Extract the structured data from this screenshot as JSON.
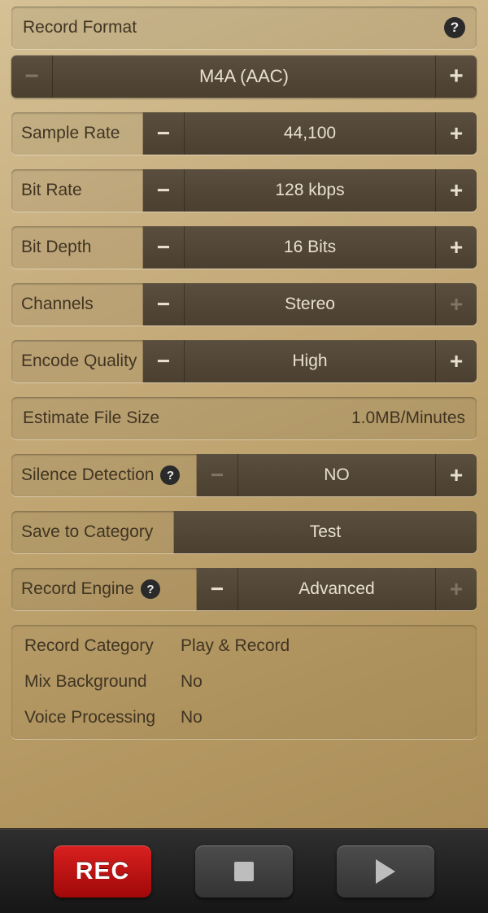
{
  "format": {
    "label": "Record Format",
    "value": "M4A (AAC)",
    "minus_enabled": false,
    "plus_enabled": true
  },
  "sample_rate": {
    "label": "Sample Rate",
    "value": "44,100"
  },
  "bit_rate": {
    "label": "Bit Rate",
    "value": "128 kbps"
  },
  "bit_depth": {
    "label": "Bit Depth",
    "value": "16 Bits"
  },
  "channels": {
    "label": "Channels",
    "value": "Stereo",
    "plus_enabled": false
  },
  "encode_quality": {
    "label": "Encode Quality",
    "value": "High"
  },
  "estimate": {
    "label": "Estimate File Size",
    "value": "1.0MB/Minutes"
  },
  "silence": {
    "label": "Silence Detection",
    "value": "NO",
    "minus_enabled": false
  },
  "category": {
    "label": "Save to Category",
    "value": "Test"
  },
  "engine": {
    "label": "Record Engine",
    "value": "Advanced",
    "plus_enabled": false
  },
  "info": {
    "record_category": {
      "k": "Record Category",
      "v": "Play & Record"
    },
    "mix_background": {
      "k": "Mix Background",
      "v": "No"
    },
    "voice_processing": {
      "k": "Voice Processing",
      "v": "No"
    }
  },
  "toolbar": {
    "rec": "REC"
  }
}
